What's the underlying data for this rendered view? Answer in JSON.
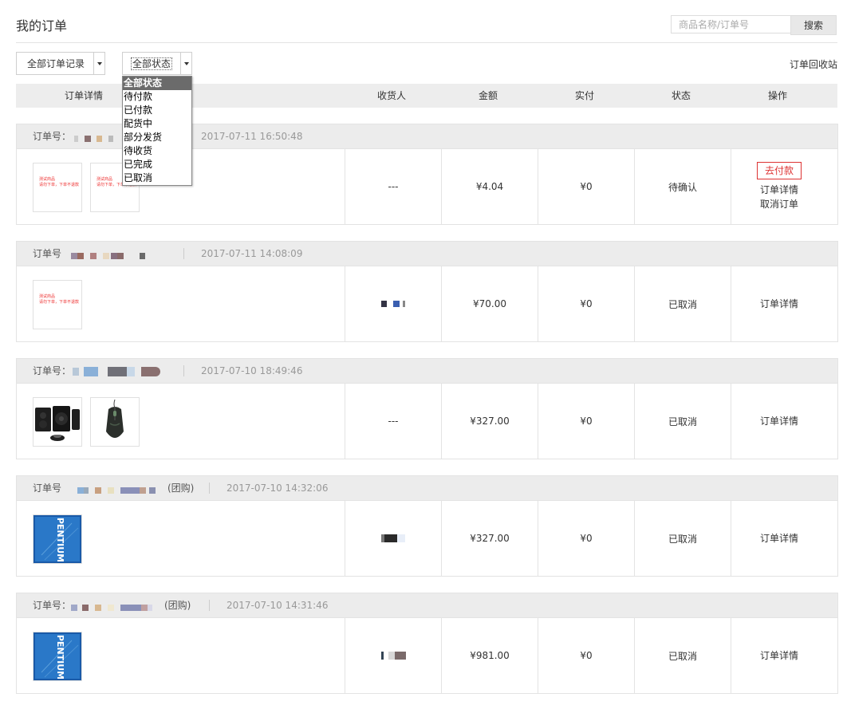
{
  "page": {
    "title": "我的订单"
  },
  "search": {
    "placeholder": "商品名称/订单号",
    "button_label": "搜索"
  },
  "filters": {
    "records_select": "全部订单记录",
    "status_select": "全部状态",
    "status_options": [
      "全部状态",
      "待付款",
      "已付款",
      "配货中",
      "部分发货",
      "待收货",
      "已完成",
      "已取消"
    ]
  },
  "recycle_bin_label": "订单回收站",
  "columns": [
    "订单详情",
    "收货人",
    "金额",
    "实付",
    "状态",
    "操作"
  ],
  "test_image_text": [
    "测试商品",
    "请勿下单，下单不退款"
  ],
  "orders": [
    {
      "number_label": "订单号：",
      "time": "2017-07-11 16:50:48",
      "receiver": "---",
      "amount": "¥4.04",
      "paid": "¥0",
      "status": "待确认",
      "ops": {
        "pay": "去付款",
        "detail": "订单详情",
        "cancel": "取消订单"
      },
      "images": [
        "test-product-image",
        "test-product-image"
      ]
    },
    {
      "number_label": "订单号",
      "time": "2017-07-11 14:08:09",
      "receiver": "",
      "amount": "¥70.00",
      "paid": "¥0",
      "status": "已取消",
      "ops": {
        "detail": "订单详情"
      },
      "images": [
        "test-product-image"
      ]
    },
    {
      "number_label": "订单号：",
      "time": "2017-07-10 18:49:46",
      "receiver": "---",
      "amount": "¥327.00",
      "paid": "¥0",
      "status": "已取消",
      "ops": {
        "detail": "订单详情"
      },
      "images": [
        "speaker-set-image",
        "gaming-mouse-image"
      ]
    },
    {
      "number_label": "订单号",
      "group_tag": "(团购)",
      "time": "2017-07-10 14:32:06",
      "receiver": "",
      "amount": "¥327.00",
      "paid": "¥0",
      "status": "已取消",
      "ops": {
        "detail": "订单详情"
      },
      "images": [
        "intel-pentium-box-image"
      ]
    },
    {
      "number_label": "订单号：",
      "group_tag": "(团购)",
      "time": "2017-07-10 14:31:46",
      "receiver": "",
      "amount": "¥981.00",
      "paid": "¥0",
      "status": "已取消",
      "ops": {
        "detail": "订单详情"
      },
      "images": [
        "intel-pentium-box-image"
      ]
    }
  ],
  "colors": {
    "accent_red": "#dd3333",
    "header_bg": "#ededed",
    "border": "#e3e3e3"
  }
}
